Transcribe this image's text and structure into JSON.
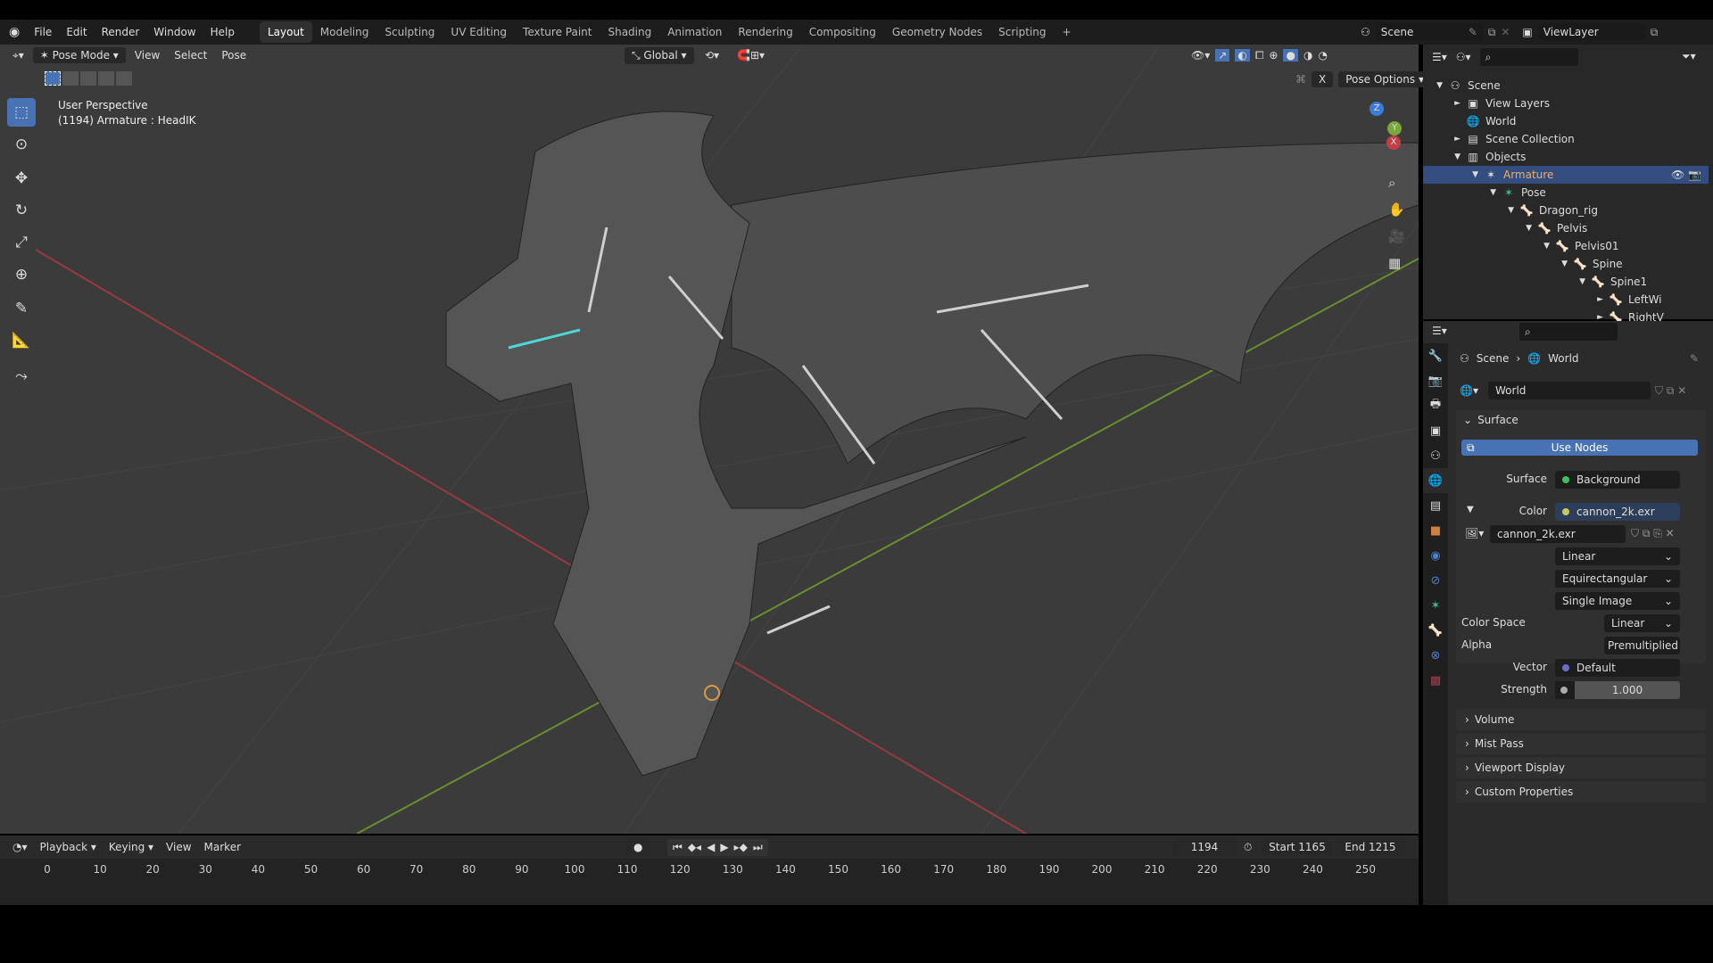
{
  "topbar": {
    "menus": [
      "File",
      "Edit",
      "Render",
      "Window",
      "Help"
    ],
    "workspaces": [
      "Layout",
      "Modeling",
      "Sculpting",
      "UV Editing",
      "Texture Paint",
      "Shading",
      "Animation",
      "Rendering",
      "Compositing",
      "Geometry Nodes",
      "Scripting"
    ],
    "active_workspace": "Layout",
    "add": "+",
    "scene": "Scene",
    "view_layer": "ViewLayer"
  },
  "viewport": {
    "mode": "Pose Mode",
    "menus": [
      "View",
      "Select",
      "Pose"
    ],
    "transform_orientation": "Global",
    "pose_options": "Pose Options",
    "x_mirror": "X",
    "overlay_title": "User Perspective",
    "overlay_sub": "(1194) Armature : HeadIK",
    "gizmo": {
      "z": "Z",
      "y": "Y",
      "x": "X"
    }
  },
  "outliner": {
    "rows": [
      {
        "label": "Scene",
        "icon": "scene-icon",
        "depth": 0,
        "arrow": "▼"
      },
      {
        "label": "View Layers",
        "icon": "view-layers-icon",
        "depth": 1,
        "arrow": "►"
      },
      {
        "label": "World",
        "icon": "world-icon",
        "depth": 1,
        "arrow": ""
      },
      {
        "label": "Scene Collection",
        "icon": "collection-icon",
        "depth": 1,
        "arrow": "►"
      },
      {
        "label": "Objects",
        "icon": "objects-icon",
        "depth": 1,
        "arrow": "▼"
      },
      {
        "label": "Armature",
        "icon": "armature-icon",
        "depth": 2,
        "arrow": "▼",
        "selected": true
      },
      {
        "label": "Pose",
        "icon": "pose-icon",
        "depth": 3,
        "arrow": "▼"
      },
      {
        "label": "Dragon_rig",
        "icon": "bone-icon",
        "depth": 4,
        "arrow": "▼"
      },
      {
        "label": "Pelvis",
        "icon": "bone-icon",
        "depth": 5,
        "arrow": "▼"
      },
      {
        "label": "Pelvis01",
        "icon": "bone-icon",
        "depth": 6,
        "arrow": "▼"
      },
      {
        "label": "Spine",
        "icon": "bone-icon",
        "depth": 7,
        "arrow": "▼"
      },
      {
        "label": "Spine1",
        "icon": "bone-icon",
        "depth": 8,
        "arrow": "▼"
      },
      {
        "label": "LeftWi",
        "icon": "bone-icon",
        "depth": 9,
        "arrow": "►"
      },
      {
        "label": "RightV",
        "icon": "bone-icon",
        "depth": 9,
        "arrow": "►"
      }
    ]
  },
  "properties": {
    "breadcrumb": [
      "Scene",
      "World"
    ],
    "world_name": "World",
    "surface_panel": "Surface",
    "use_nodes": "Use Nodes",
    "surface_label": "Surface",
    "surface_value": "Background",
    "color_label": "Color",
    "color_value": "cannon_2k.exr",
    "image_name": "cannon_2k.exr",
    "interpolation": "Linear",
    "projection": "Equirectangular",
    "source": "Single Image",
    "color_space_label": "Color Space",
    "color_space": "Linear",
    "alpha_label": "Alpha",
    "alpha": "Premultiplied",
    "vector_label": "Vector",
    "vector": "Default",
    "strength_label": "Strength",
    "strength": "1.000",
    "panels": [
      "Volume",
      "Mist Pass",
      "Viewport Display",
      "Custom Properties"
    ]
  },
  "timeline": {
    "menus": [
      "Playback",
      "Keying",
      "View",
      "Marker"
    ],
    "current_frame": "1194",
    "start": "Start 1165",
    "end": "End 1215",
    "ticks": [
      "0",
      "10",
      "20",
      "30",
      "40",
      "50",
      "60",
      "70",
      "80",
      "90",
      "100",
      "110",
      "120",
      "130",
      "140",
      "150",
      "160",
      "170",
      "180",
      "190",
      "200",
      "210",
      "220",
      "230",
      "240",
      "250"
    ]
  },
  "colors": {
    "accent": "#4772b3",
    "selected_row": "#334d80",
    "bone": "#3fbf8f",
    "x_axis": "#c0404a",
    "y_axis": "#7aa83a"
  }
}
